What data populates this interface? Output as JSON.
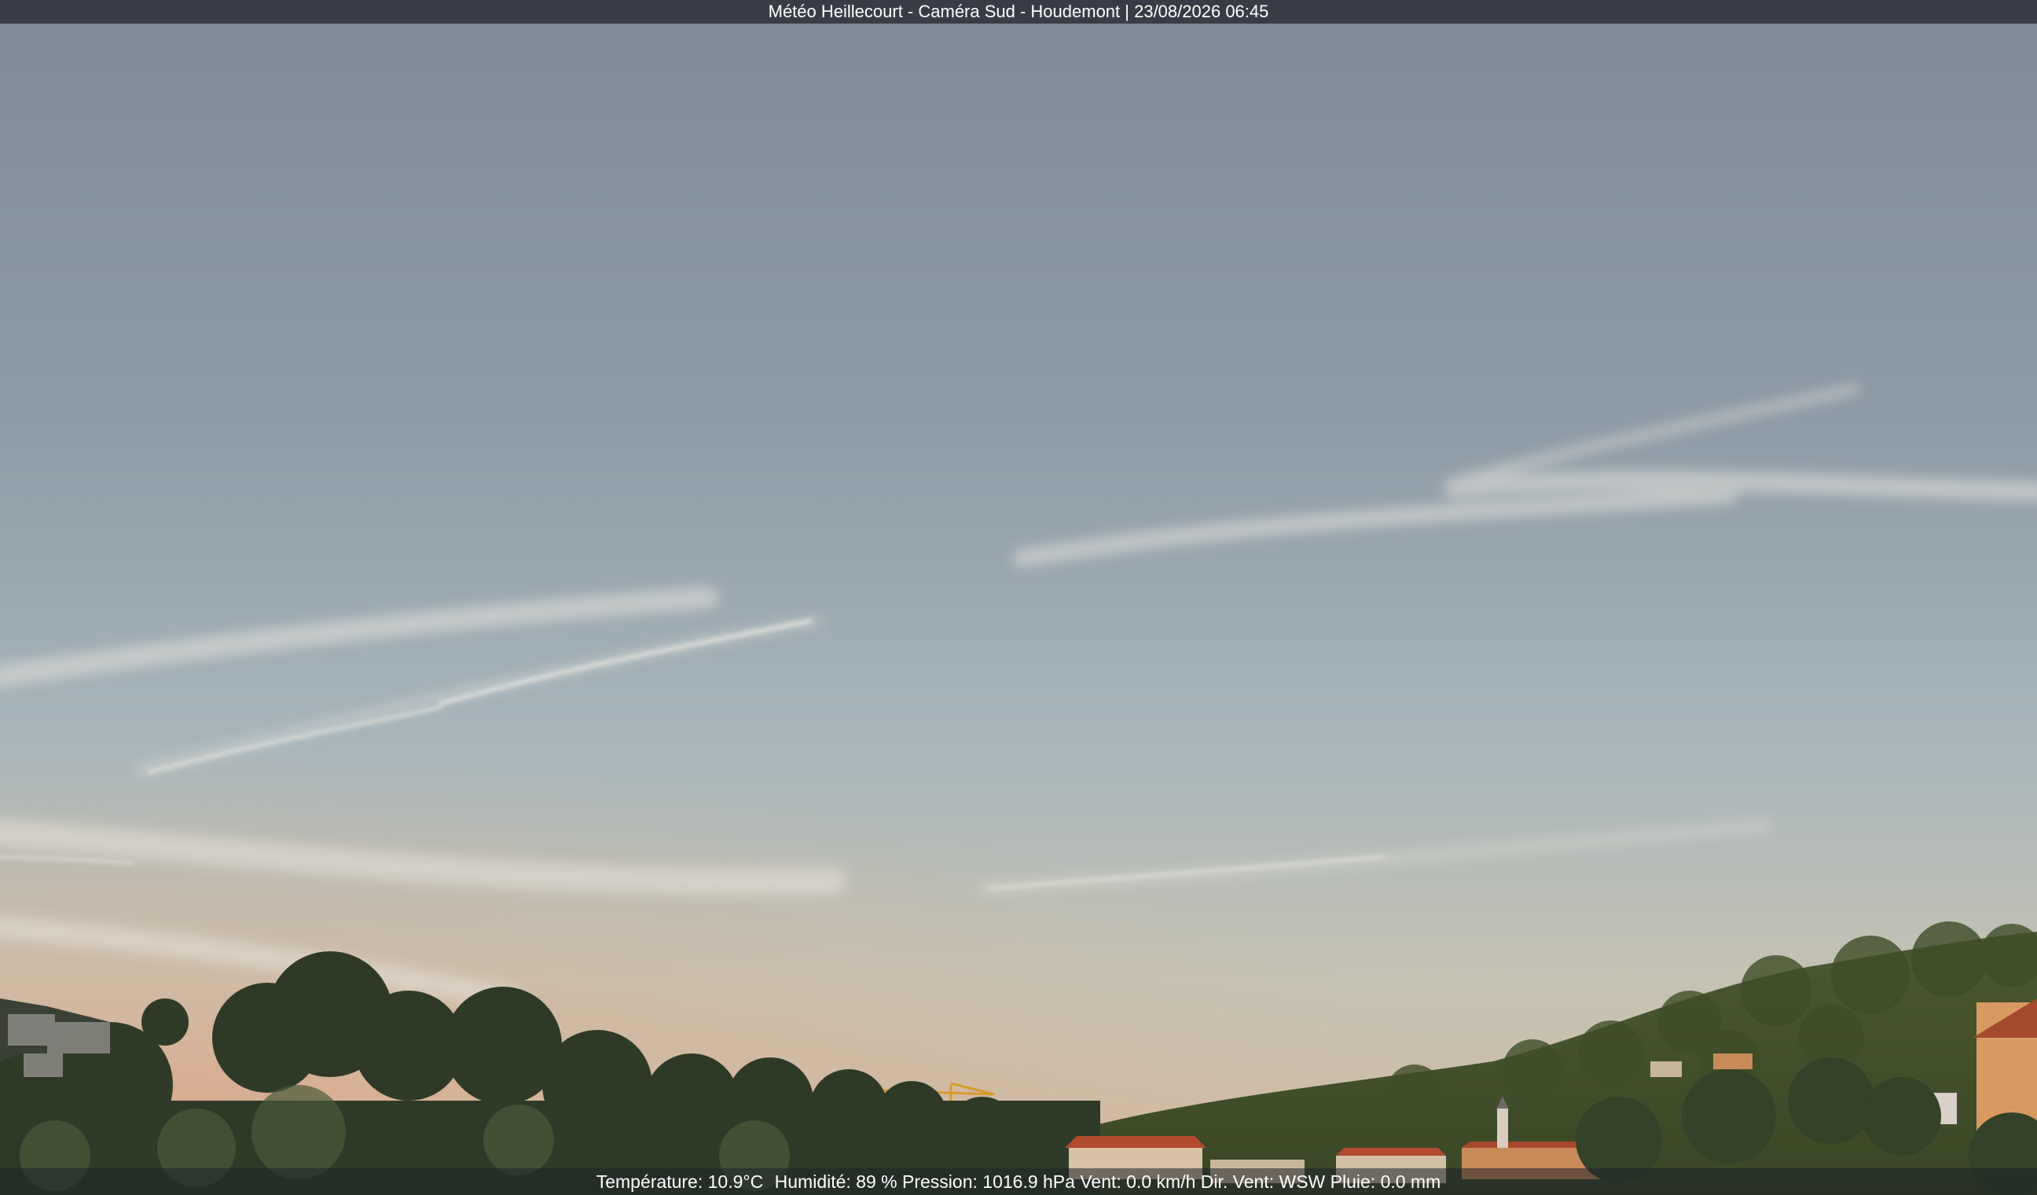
{
  "header": {
    "title": "Météo Heillecourt - Caméra Sud - Houdemont | 23/08/2026 06:45"
  },
  "footer": {
    "temperature": "Température: 10.9°C",
    "humidity": "Humidité: 89 %",
    "pressure": "Pression: 1016.9 hPa",
    "wind": "Vent: 0.0 km/h",
    "wind_dir": "Dir. Vent: WSW",
    "rain": "Pluie: 0.0 mm"
  },
  "scene": {
    "sky_top_color": "#7f8b99",
    "sky_mid_color": "#a4b2ba",
    "sky_horizon_color": "#d2b8a0",
    "horizon_glow_color": "#e3a27e",
    "trees_color": "#2f3a26",
    "hill_color": "#4a5a30",
    "roof_color": "#b24a30",
    "crane_color": "#d79a2a"
  }
}
